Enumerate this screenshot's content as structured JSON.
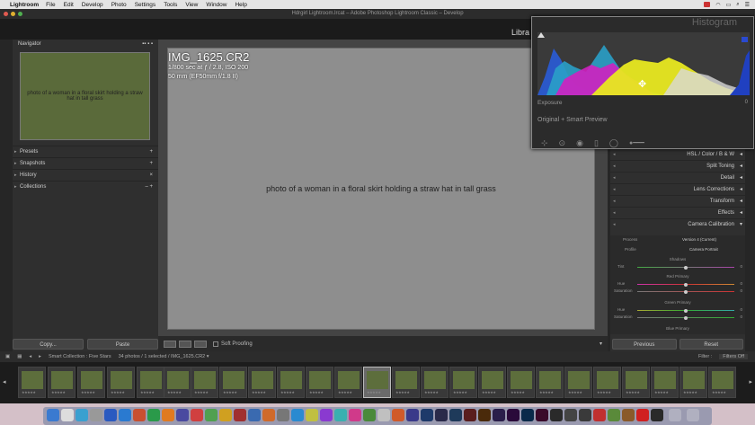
{
  "menubar": {
    "app": "Lightroom",
    "items": [
      "File",
      "Edit",
      "Develop",
      "Photo",
      "Settings",
      "Tools",
      "View",
      "Window",
      "Help"
    ]
  },
  "window_title": "Hdrgirl Lightroom.lrcat – Adobe Photoshop Lightroom Classic – Develop",
  "module_label": "Libra",
  "left": {
    "navigator": "Navigator",
    "panels": [
      {
        "label": "Presets",
        "action": "+"
      },
      {
        "label": "Snapshots",
        "action": "+"
      },
      {
        "label": "History",
        "action": "×"
      },
      {
        "label": "Collections",
        "action": "– +"
      }
    ],
    "copy": "Copy...",
    "paste": "Paste"
  },
  "photo": {
    "filename": "IMG_1625.CR2",
    "line1": "1/800 sec at ƒ / 2.8, ISO 200",
    "line2": "50 mm (EF50mm f/1.8 II)",
    "placeholder": "photo of a woman in a floral skirt holding a straw hat in tall grass"
  },
  "toolbar": {
    "soft_proofing": "Soft Proofing"
  },
  "right": {
    "panels": [
      "Split Toning",
      "Detail",
      "Lens Corrections",
      "Transform",
      "Effects",
      "Camera Calibration"
    ],
    "hsl": "HSL / Color / B & W",
    "process_label": "Process",
    "process_value": "Version 4 (Current)",
    "profile_label": "Profile",
    "profile_value": "Camera Portrait",
    "shadows": "Shadows",
    "tint": "Tint",
    "red_primary": "Red Primary",
    "hue": "Hue",
    "saturation": "Saturation",
    "green_primary": "Green Primary",
    "blue_primary": "Blue Primary",
    "previous": "Previous",
    "reset": "Reset",
    "values": [
      "0",
      "0",
      "0",
      "0",
      "0"
    ]
  },
  "histogram": {
    "title": "Histogram",
    "exposure": "Exposure",
    "preview": "Original + Smart Preview",
    "exposure_value": "0"
  },
  "filmstrip": {
    "collection": "Smart Collection : Five Stars",
    "count": "34 photos / 1 selected / IMG_1625.CR2 ▾",
    "filter_label": "Filter :",
    "filter_value": "Filters Off",
    "stars": "★★★★★"
  }
}
